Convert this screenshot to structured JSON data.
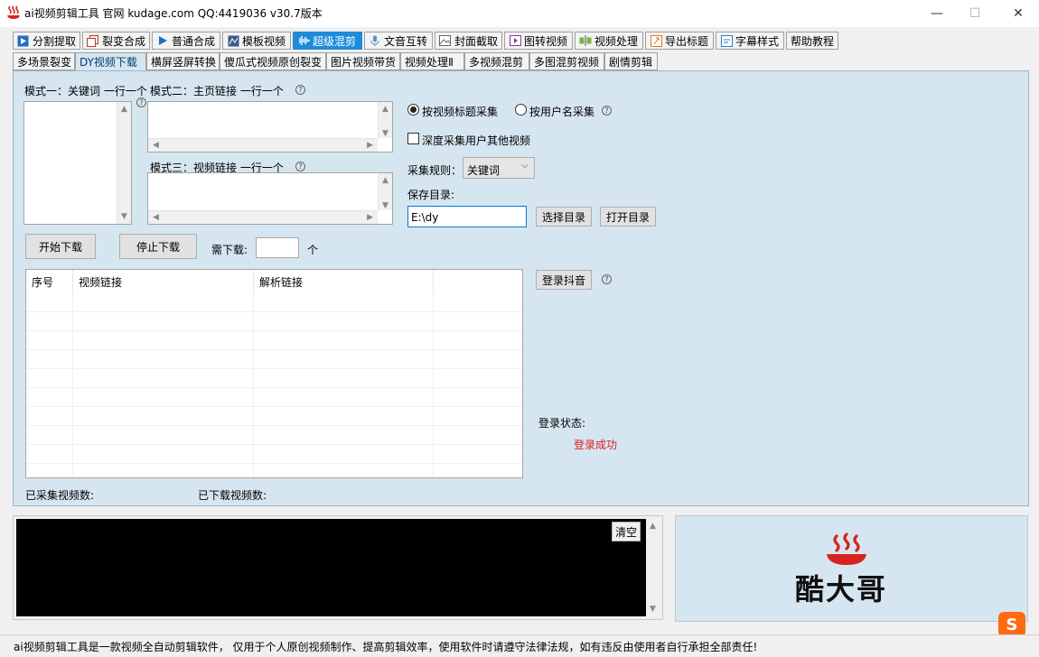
{
  "window": {
    "title": "ai视频剪辑工具 官网 kudage.com QQ:4419036   v30.7版本",
    "minimize": "—",
    "maximize": "☐",
    "close": "✕"
  },
  "main_tabs": [
    {
      "label": "分割提取",
      "icon": "play-square-icon"
    },
    {
      "label": "裂变合成",
      "icon": "copy-icon"
    },
    {
      "label": "普通合成",
      "icon": "play-icon"
    },
    {
      "label": "模板视频",
      "icon": "template-icon"
    },
    {
      "label": "超级混剪",
      "icon": "waveform-icon"
    },
    {
      "label": "文音互转",
      "icon": "microphone-icon"
    },
    {
      "label": "封面截取",
      "icon": "image-icon"
    },
    {
      "label": "图转视频",
      "icon": "film-icon"
    },
    {
      "label": "视频处理",
      "icon": "split-icon"
    },
    {
      "label": "导出标题",
      "icon": "export-icon"
    },
    {
      "label": "字幕样式",
      "icon": "subtitle-icon"
    },
    {
      "label": "帮助教程",
      "icon": ""
    }
  ],
  "sub_tabs": [
    "多场景裂变",
    "DY视频下载",
    "横屏竖屏转换",
    "傻瓜式视频原创裂变",
    "图片视频带货",
    "视频处理Ⅱ",
    "多视频混剪",
    "多图混剪视频",
    "剧情剪辑"
  ],
  "form": {
    "mode1_label": "模式一：关键词 一行一个",
    "mode2_label": "模式二：主页链接 一行一个",
    "mode3_label": "模式三：视频链接 一行一个",
    "radio_title": "按视频标题采集",
    "radio_user": "按用户名采集",
    "deep_collect": "深度采集用户其他视频",
    "rule_label": "采集规则：",
    "rule_value": "关键词",
    "save_dir_label": "保存目录:",
    "save_dir_value": "E:\\dy",
    "choose_dir": "选择目录",
    "open_dir": "打开目录",
    "start_download": "开始下载",
    "stop_download": "停止下载",
    "need_download": "需下载:",
    "need_download_value": "",
    "unit": "个",
    "login_douyin": "登录抖音",
    "login_status_label": "登录状态:",
    "login_status_value": "登录成功",
    "collected_count": "已采集视频数:",
    "downloaded_count": "已下载视频数:"
  },
  "table": {
    "headers": [
      "序号",
      "视频链接",
      "解析链接"
    ]
  },
  "log": {
    "clear": "清空"
  },
  "logo": {
    "text": "酷大哥"
  },
  "status_bar": "ai视频剪辑工具是一款视频全自动剪辑软件， 仅用于个人原创视频制作、提高剪辑效率，使用软件时请遵守法律法规，如有违反由使用者自行承担全部责任!",
  "colors": {
    "accent": "#1e8cdb",
    "panel": "#d6e6f0",
    "success": "#e02020",
    "logo_red": "#d8231d"
  }
}
